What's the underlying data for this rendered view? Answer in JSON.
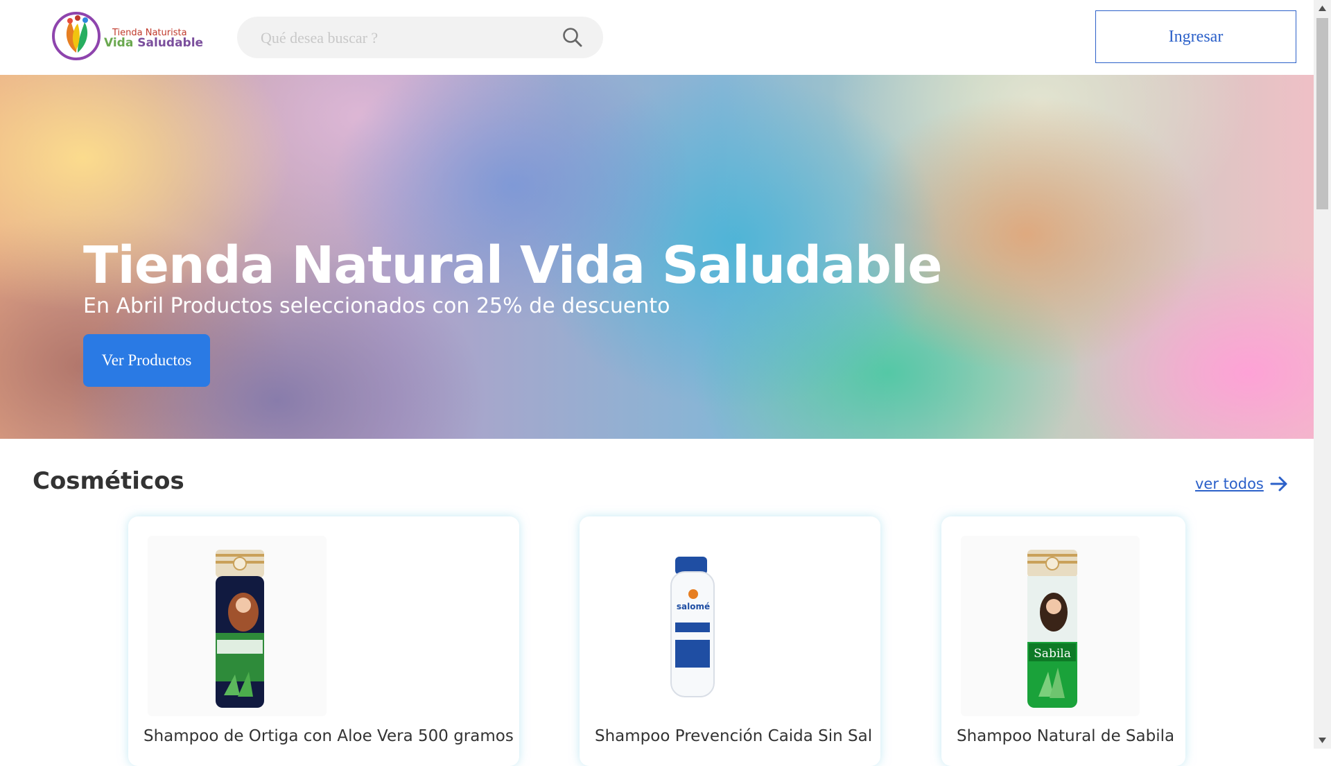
{
  "header": {
    "logo": {
      "line1": "Tienda Naturista",
      "line2_a": "Vida",
      "line2_b": "Saludable"
    },
    "search": {
      "placeholder": "Qué desea buscar ?",
      "value": ""
    },
    "login_label": "Ingresar"
  },
  "hero": {
    "title": "Tienda Natural Vida Saludable",
    "subtitle": "En Abril Productos seleccionados con 25% de descuento",
    "button_label": "Ver Productos"
  },
  "section": {
    "title": "Cosméticos",
    "see_all_label": "ver todos",
    "products": [
      {
        "name": "Shampoo de Ortiga con Aloe Vera 500 gramos"
      },
      {
        "name": "Shampoo Prevención Caida Sin Sal"
      },
      {
        "name": "Shampoo Natural de Sabila"
      }
    ]
  },
  "colors": {
    "accent": "#2b60c9",
    "button": "#2a7ae4"
  },
  "icons": [
    "search-icon",
    "arrow-right-icon"
  ]
}
